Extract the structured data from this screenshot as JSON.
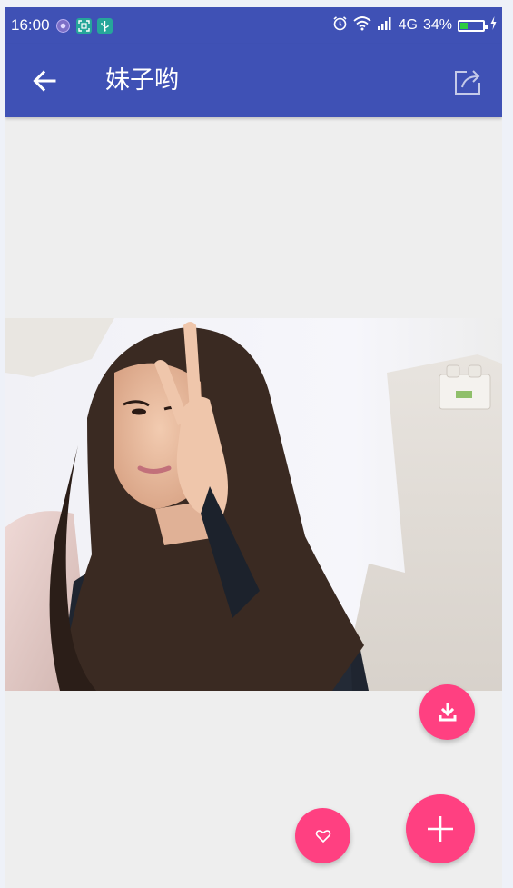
{
  "status_bar": {
    "time": "16:00",
    "network": "4G",
    "battery_percent": "34%",
    "battery_level": 0.34,
    "icons": [
      "location-icon",
      "screenshot-icon",
      "usb-icon",
      "alarm-icon",
      "wifi-icon",
      "signal-icon",
      "battery-icon"
    ]
  },
  "app_bar": {
    "title": "妹子哟",
    "back_icon": "arrow-left-icon",
    "share_icon": "share-icon"
  },
  "photo": {
    "subject": "selfie-photo"
  },
  "fabs": {
    "download_icon": "download-icon",
    "like_icon": "heart-icon",
    "add_icon": "plus-icon"
  },
  "colors": {
    "primary": "#3f51b5",
    "accent": "#ff4081",
    "background": "#eeeeee"
  }
}
